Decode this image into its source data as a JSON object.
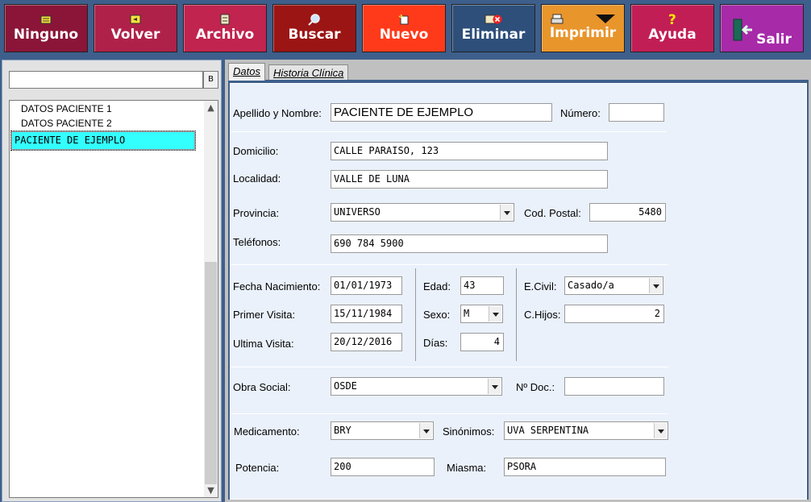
{
  "toolbar": {
    "ninguno": {
      "label": "Ninguno",
      "color": "#8a1538"
    },
    "volver": {
      "label": "Volver",
      "color": "#b0214a"
    },
    "archivo": {
      "label": "Archivo",
      "color": "#c0244f"
    },
    "buscar": {
      "label": "Buscar",
      "color": "#9b1515"
    },
    "nuevo": {
      "label": "Nuevo",
      "color": "#ff3a1a"
    },
    "eliminar": {
      "label": "Eliminar",
      "color": "#2d4f7a"
    },
    "imprimir": {
      "label": "Imprimir",
      "color": "#e8952c"
    },
    "ayuda": {
      "label": "Ayuda",
      "color": "#c21e56"
    },
    "salir": {
      "label": "Salir",
      "color": "#a72aa8"
    }
  },
  "sidebar": {
    "search_value": "",
    "search_button": "B",
    "patients": [
      "DATOS PACIENTE 1",
      "DATOS PACIENTE 2",
      "PACIENTE DE EJEMPLO"
    ],
    "selected_color": "#33ffff"
  },
  "tabs": {
    "datos": "Datos",
    "historia": "Historia Clínica"
  },
  "form": {
    "apellido_label": "Apellido y Nombre:",
    "apellido_value": "PACIENTE DE EJEMPLO",
    "numero_label": "Número:",
    "numero_value": "",
    "domicilio_label": "Domicilio:",
    "domicilio_value": "CALLE PARAISO, 123",
    "localidad_label": "Localidad:",
    "localidad_value": "VALLE DE LUNA",
    "provincia_label": "Provincia:",
    "provincia_value": "UNIVERSO",
    "cod_postal_label": "Cod. Postal:",
    "cod_postal_value": "5480",
    "telefonos_label": "Teléfonos:",
    "telefonos_value": "690 784 5900",
    "fecha_nac_label": "Fecha Nacimiento:",
    "fecha_nac_value": "01/01/1973",
    "primer_visita_label": "Primer Visita:",
    "primer_visita_value": "15/11/1984",
    "ultima_visita_label": "Ultima Visita:",
    "ultima_visita_value": "20/12/2016",
    "edad_label": "Edad:",
    "edad_value": "43",
    "sexo_label": "Sexo:",
    "sexo_value": "M",
    "dias_label": "Días:",
    "dias_value": "4",
    "ecivil_label": "E.Civil:",
    "ecivil_value": "Casado/a",
    "chijos_label": "C.Hijos:",
    "chijos_value": "2",
    "obra_social_label": "Obra Social:",
    "obra_social_value": "OSDE",
    "ndoc_label": "Nº Doc.:",
    "ndoc_value": "",
    "medicamento_label": "Medicamento:",
    "medicamento_value": "BRY",
    "sinonimos_label": "Sinónimos:",
    "sinonimos_value": "UVA SERPENTINA",
    "potencia_label": "Potencia:",
    "potencia_value": "200",
    "miasma_label": "Miasma:",
    "miasma_value": "PSORA"
  }
}
